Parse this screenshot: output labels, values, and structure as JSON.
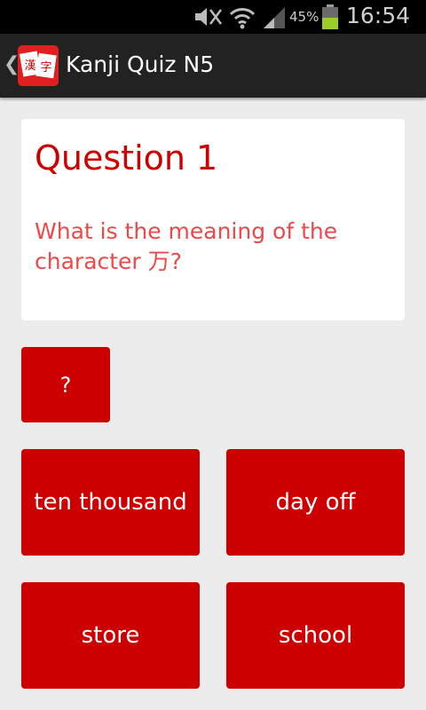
{
  "status_bar": {
    "icons": [
      "mute-icon",
      "wifi-icon",
      "signal-icon",
      "battery-icon"
    ],
    "battery_percent": "45%",
    "time": "16:54"
  },
  "action_bar": {
    "title": "Kanji Quiz N5",
    "app_icon": "kanji-card-icon"
  },
  "question": {
    "title": "Question 1",
    "text": "What is the meaning of the character 万?"
  },
  "hint_button": {
    "label": "?"
  },
  "answers": [
    {
      "label": "ten thousand"
    },
    {
      "label": "day off"
    },
    {
      "label": "store"
    },
    {
      "label": "school"
    }
  ],
  "colors": {
    "accent": "#cc0000",
    "question_text": "#f04848",
    "background": "#ececec",
    "action_bar": "#222222"
  }
}
